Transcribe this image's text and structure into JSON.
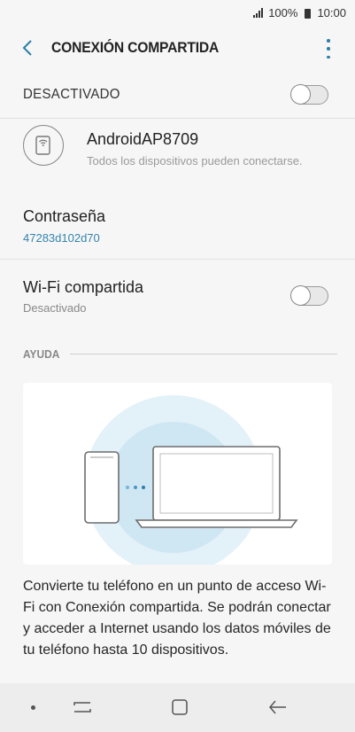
{
  "status_bar": {
    "battery": "100%",
    "time": "10:00",
    "signal_icon": "signal-bars-icon",
    "battery_icon": "battery-icon"
  },
  "app_bar": {
    "title": "CONEXIÓN COMPARTIDA",
    "back_icon": "chevron-left-icon",
    "more_icon": "more-vert-icon"
  },
  "master_switch": {
    "label": "DESACTIVADO",
    "state": "off"
  },
  "access_point": {
    "name": "AndroidAP8709",
    "subtitle": "Todos los dispositivos pueden conectarse.",
    "icon": "hotspot-device-icon"
  },
  "password": {
    "title": "Contraseña",
    "value": "47283d102d70"
  },
  "wifi_sharing": {
    "title": "Wi-Fi compartida",
    "status": "Desactivado",
    "state": "off"
  },
  "help": {
    "header": "AYUDA",
    "text": "Convierte tu teléfono en un punto de acceso Wi-Fi con Conexión compartida. Se podrán conectar y acceder a Internet usando los datos móviles de tu teléfono hasta 10 dispositivos."
  },
  "colors": {
    "accent": "#2d7fa8",
    "password_link": "#3584ad",
    "background": "#f6f6f6",
    "illustration_circle": "#d7ebf6"
  },
  "nav_bar": {
    "dot_icon": "dot-icon",
    "recent_icon": "recent-apps-icon",
    "home_icon": "home-icon",
    "back_icon": "back-arrow-icon"
  }
}
